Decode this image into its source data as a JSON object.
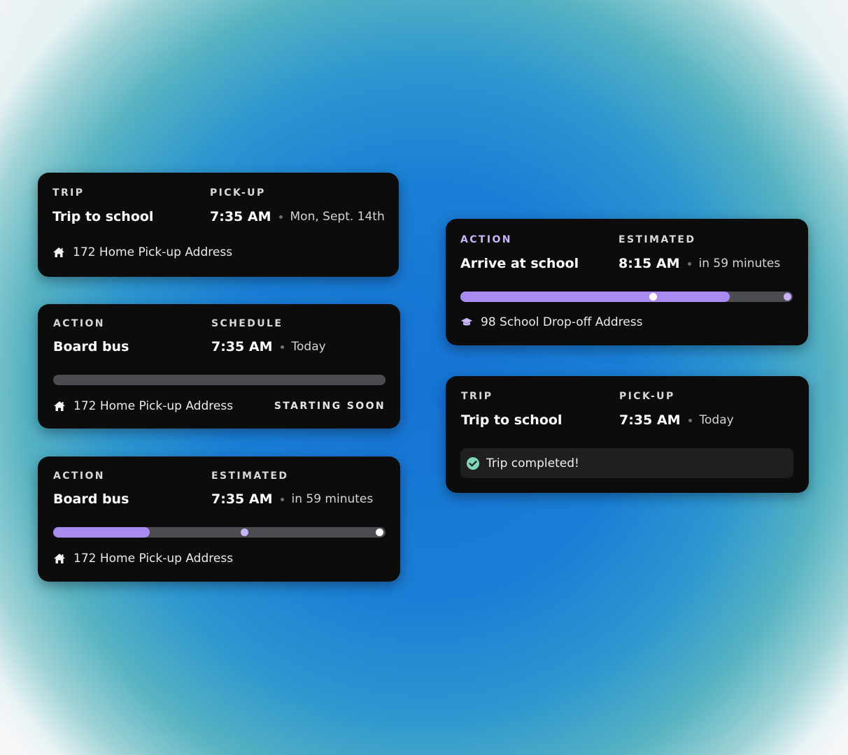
{
  "colors": {
    "accent": "#a98af0",
    "card_bg": "#0c0c0d",
    "track": "#4b4b50",
    "check": "#7fd6b8"
  },
  "cards": [
    {
      "left_label": "TRIP",
      "left_value": "Trip to school",
      "right_label": "PICK-UP",
      "time": "7:35 AM",
      "when": "Mon, Sept. 14th",
      "address": "172 Home Pick-up Address",
      "address_icon": "home-icon"
    },
    {
      "left_label": "ACTION",
      "left_value": "Board bus",
      "right_label": "SCHEDULE",
      "time": "7:35 AM",
      "when": "Today",
      "address": "172 Home Pick-up Address",
      "address_icon": "home-icon",
      "progress": 0,
      "status": "STARTING SOON"
    },
    {
      "left_label": "ACTION",
      "left_value": "Board bus",
      "right_label": "ESTIMATED",
      "time": "7:35 AM",
      "when": "in 59 minutes",
      "address": "172 Home Pick-up Address",
      "address_icon": "home-icon",
      "progress": 0.29
    },
    {
      "left_label": "ACTION",
      "left_value": "Arrive at school",
      "right_label": "ESTIMATED",
      "time": "8:15 AM",
      "when": "in 59 minutes",
      "address": "98 School Drop-off Address",
      "address_icon": "graduation-cap-icon",
      "progress": 0.81
    },
    {
      "left_label": "TRIP",
      "left_value": "Trip to school",
      "right_label": "PICK-UP",
      "time": "7:35 AM",
      "when": "Today",
      "completed_text": "Trip completed!",
      "completed_icon": "check-circle-icon"
    }
  ]
}
